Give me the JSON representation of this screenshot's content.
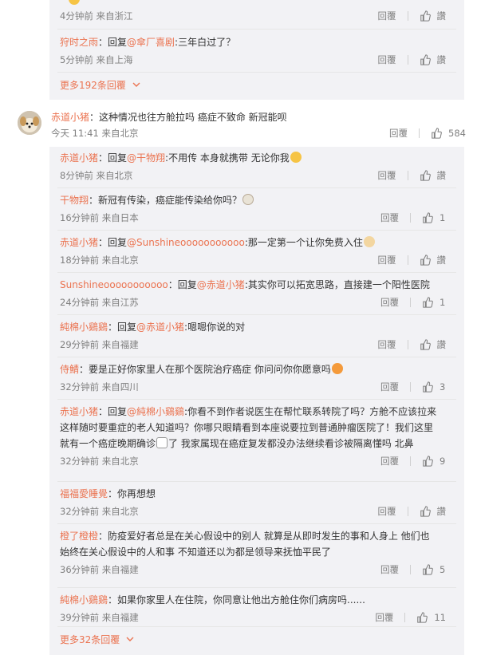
{
  "top_thread": {
    "prev_item": {
      "meta": "4分钟前 来自浙江",
      "reply_label": "回覆",
      "like_label": "讚"
    },
    "item2": {
      "user": "狩时之雨",
      "reply_prefix": "：回复",
      "at": "@傘厂喜剧",
      "text": ":三年白过了？",
      "meta": "5分钟前 来自上海",
      "reply_label": "回覆",
      "like_label": "讚"
    },
    "more": "更多192条回覆"
  },
  "main_comment": {
    "user": "赤道小猪",
    "text": "：这种情况也往方舱拉吗 癌症不致命 新冠能呗",
    "meta": "今天 11:41 来自北京",
    "reply_label": "回覆",
    "like_count": "584"
  },
  "replies": [
    {
      "user": "赤道小猪",
      "pre": "：回复",
      "at": "@干物翔",
      "text": ":不用传 本身就携带 无论你我",
      "emoji": "hug",
      "meta": "8分钟前 来自北京",
      "reply_label": "回覆",
      "like": "讚"
    },
    {
      "user": "干物翔",
      "pre": "",
      "at": "",
      "text": "：新冠有传染，癌症能传染给你吗？",
      "emoji": "dog",
      "meta": "16分钟前 来自日本",
      "reply_label": "回覆",
      "like": "1"
    },
    {
      "user": "赤道小猪",
      "pre": "：回复",
      "at": "@Sunshineooooooooooo",
      "text": ":那一定第一个让你免费入住",
      "emoji": "cat",
      "meta": "18分钟前 来自北京",
      "reply_label": "回覆",
      "like": "讚"
    },
    {
      "user": "Sunshineooooooooooo",
      "pre": "：回复",
      "at": "@赤道小猪",
      "text": ":其实你可以拓宽思路，直接建一个阳性医院",
      "emoji": "",
      "meta": "24分钟前 来自江苏",
      "reply_label": "回覆",
      "like": "1"
    },
    {
      "user": "純棉小鷄鷄",
      "pre": "：回复",
      "at": "@赤道小猪",
      "text": ":嗯嗯你说的对",
      "emoji": "",
      "meta": "29分钟前 来自福建",
      "reply_label": "回覆",
      "like": "讚"
    },
    {
      "user": "侍鯖",
      "pre": "",
      "at": "",
      "text": "：要是正好你家里人在那个医院治疗癌症 你问问你你愿意吗",
      "emoji": "fire",
      "meta": "32分钟前 来自四川",
      "reply_label": "回覆",
      "like": "3"
    },
    {
      "user": "赤道小猪",
      "pre": "：回复",
      "at": "@純棉小鷄鷄",
      "text": ":你看不到作者说医生在帮忙联系转院了吗？方舱不应该拉来这样随时要重症的老人知道吗？你哪只眼睛看到本座说要拉到普通肿瘤医院了！我们这里就有一个癌症晚期确诊",
      "emoji": "hand",
      "text2": "了 我家属现在癌症复发都没办法继续看诊被隔离懂吗 北鼻",
      "meta": "32分钟前 来自北京",
      "reply_label": "回覆",
      "like": "9"
    },
    {
      "user": "福福愛睡覺",
      "pre": "",
      "at": "",
      "text": "：你再想想",
      "emoji": "",
      "meta": "32分钟前 来自北京",
      "reply_label": "回覆",
      "like": "讚"
    },
    {
      "user": "橙了橙橙",
      "pre": "",
      "at": "",
      "text": "：防疫爱好者总是在关心假设中的别人 就算是从即时发生的事和人身上 他们也始终在关心假设中的人和事 不知道还以为都是领导来抚恤平民了",
      "emoji": "",
      "meta": "36分钟前 来自福建",
      "reply_label": "回覆",
      "like": "5"
    },
    {
      "user": "純棉小鷄鷄",
      "pre": "",
      "at": "",
      "text": "：如果你家里人在住院，你同意让他出方舱住你们病房吗......",
      "emoji": "",
      "meta": "39分钟前 来自福建",
      "reply_label": "回覆",
      "like": "11"
    }
  ],
  "more_bottom": "更多32条回覆",
  "colors": {
    "accent": "#eb7350",
    "panel": "#f2f2f5",
    "meta": "#808080"
  },
  "icons": {
    "like": "thumbs-up-icon",
    "chevron": "chevron-down-icon",
    "avatar": "dog-avatar"
  }
}
